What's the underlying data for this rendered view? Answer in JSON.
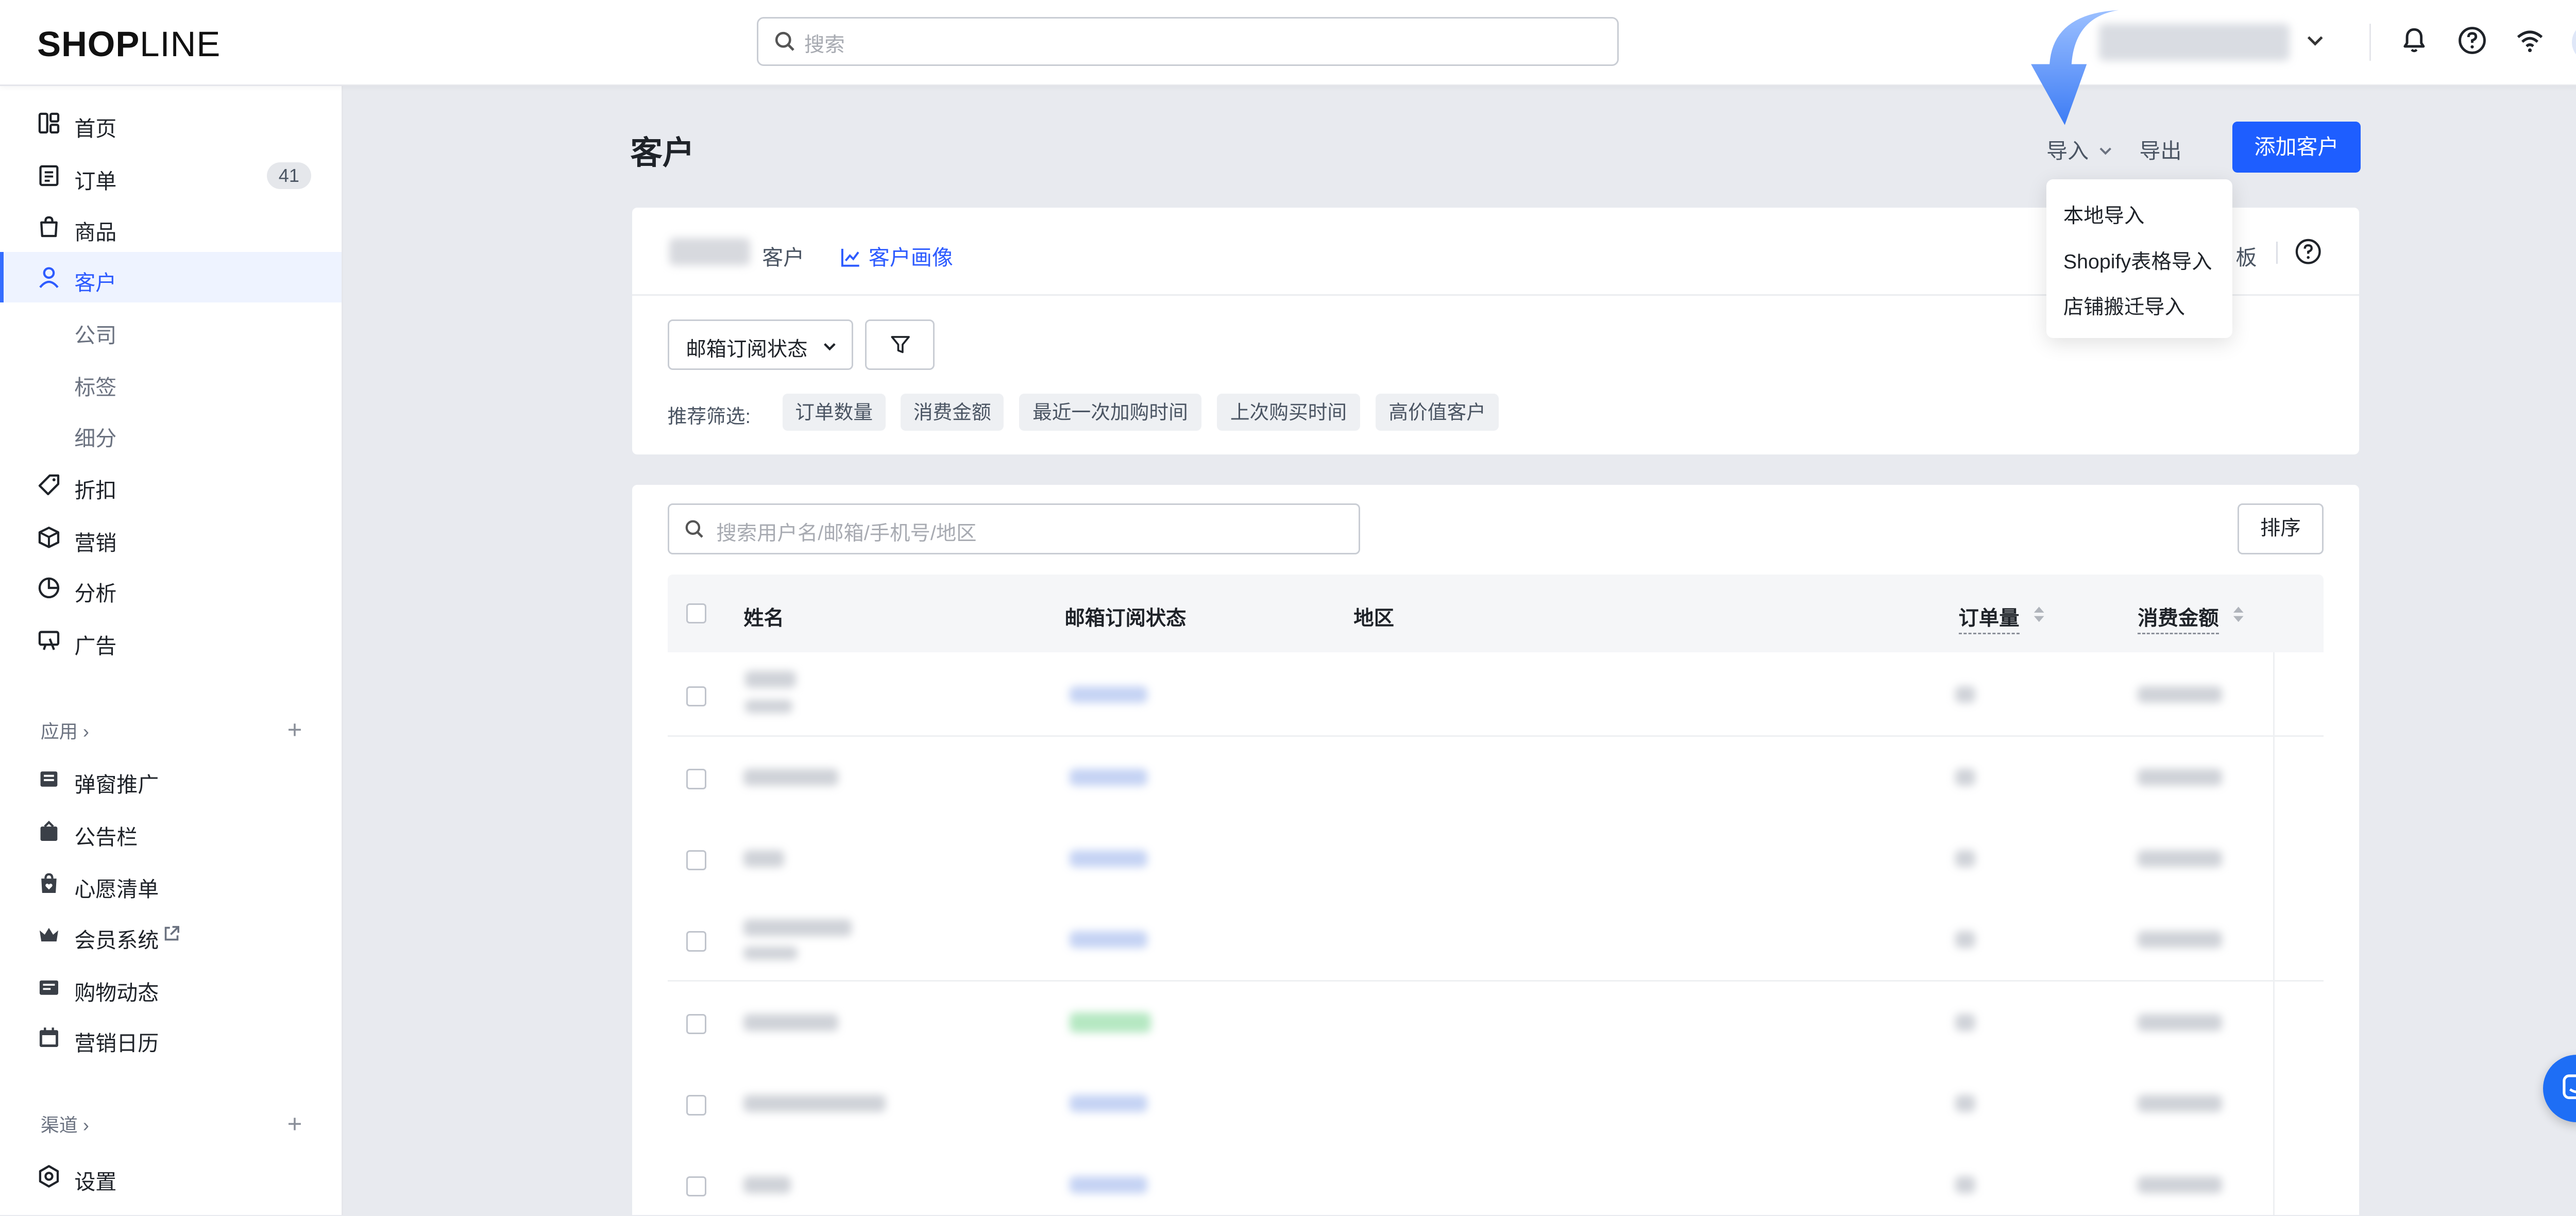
{
  "brand": {
    "logo_bold": "SHOP",
    "logo_light": "LINE"
  },
  "header": {
    "search_placeholder": "搜索"
  },
  "sidebar": {
    "items": [
      {
        "label": "首页",
        "icon": "home-icon"
      },
      {
        "label": "订单",
        "icon": "order-icon",
        "badge": "41"
      },
      {
        "label": "商品",
        "icon": "product-bag-icon"
      },
      {
        "label": "客户",
        "icon": "customer-icon",
        "active": true
      },
      {
        "label": "公司"
      },
      {
        "label": "标签"
      },
      {
        "label": "细分"
      },
      {
        "label": "折扣",
        "icon": "discount-tag-icon"
      },
      {
        "label": "营销",
        "icon": "marketing-cube-icon"
      },
      {
        "label": "分析",
        "icon": "analytics-pie-icon"
      },
      {
        "label": "广告",
        "icon": "ads-icon"
      }
    ],
    "apps_header": "应用",
    "apps": [
      {
        "label": "弹窗推广",
        "icon": "popup-icon"
      },
      {
        "label": "公告栏",
        "icon": "announcement-icon"
      },
      {
        "label": "心愿清单",
        "icon": "wishlist-icon"
      },
      {
        "label": "会员系统",
        "icon": "crown-icon"
      },
      {
        "label": "购物动态",
        "icon": "shopping-feed-icon"
      },
      {
        "label": "营销日历",
        "icon": "calendar-icon"
      }
    ],
    "channels_header": "渠道",
    "settings_label": "设置"
  },
  "page": {
    "title": "客户",
    "import_label": "导入",
    "export_label": "导出",
    "add_label": "添加客户"
  },
  "import_menu": [
    "本地导入",
    "Shopify表格导入",
    "店铺搬迁导入"
  ],
  "summary": {
    "customers_suffix": "客户",
    "portrait_label": "客户画像",
    "template_partial": "板"
  },
  "filters": {
    "email_status_select": "邮箱订阅状态",
    "recommend_label": "推荐筛选:",
    "chips": [
      "订单数量",
      "消费金额",
      "最近一次加购时间",
      "上次购买时间",
      "高价值客户"
    ]
  },
  "list": {
    "search_placeholder": "搜索用户名/邮箱/手机号/地区",
    "sort_label": "排序",
    "columns": {
      "name": "姓名",
      "email_status": "邮箱订阅状态",
      "region": "地区",
      "orders": "订单量",
      "spent": "消费金额"
    }
  },
  "colors": {
    "primary": "#1E5EFF",
    "active_nav": "#2D5BFF",
    "page_bg": "#E8EAEF"
  }
}
